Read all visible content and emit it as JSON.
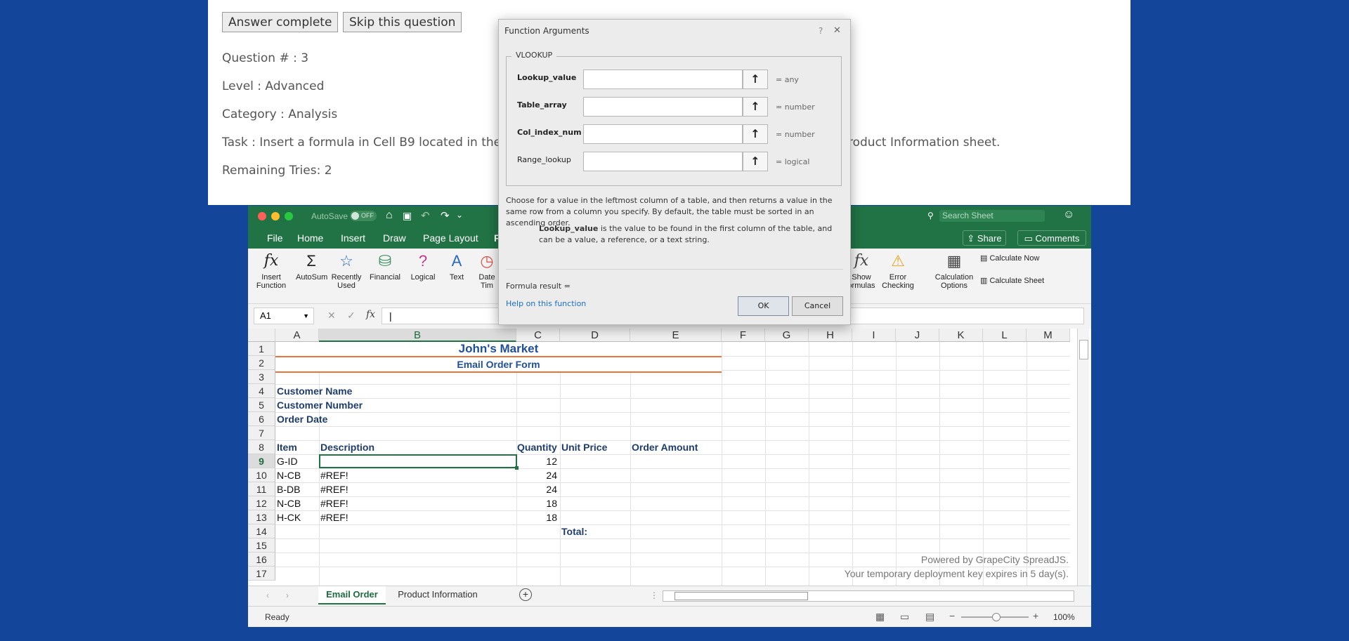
{
  "question": {
    "answer_complete_label": "Answer complete",
    "skip_label": "Skip this question",
    "number": "Question # : 3",
    "level": "Level : Advanced",
    "category": "Category : Analysis",
    "task_part1": "Task : Insert a formula in Cell B9 located in the Ema",
    "task_part2": "roduct Information sheet.",
    "remaining": "Remaining Tries: 2"
  },
  "titlebar": {
    "autosave": "AutoSave",
    "autosave_state": "OFF",
    "search_placeholder": "Search Sheet"
  },
  "ribbon_tabs": [
    "File",
    "Home",
    "Insert",
    "Draw",
    "Page Layout",
    "F"
  ],
  "share_label": "Share",
  "comments_label": "Comments",
  "ribbon": {
    "insert_function": [
      "Insert",
      "Function"
    ],
    "autosum": "AutoSum",
    "recently_used": [
      "Recently",
      "Used"
    ],
    "financial": "Financial",
    "logical": "Logical",
    "text": "Text",
    "datetime": [
      "Date",
      "Tim"
    ],
    "show_formulas": [
      "Show",
      "ormulas"
    ],
    "error_checking": [
      "Error",
      "Checking"
    ],
    "calc_options": [
      "Calculation",
      "Options"
    ],
    "calculate_now": "Calculate Now",
    "calculate_sheet": "Calculate Sheet"
  },
  "formula_bar": {
    "name_box": "A1",
    "fx": "fx",
    "value": "|"
  },
  "columns": [
    "A",
    "B",
    "C",
    "D",
    "E",
    "F",
    "G",
    "H",
    "I",
    "J",
    "K",
    "L",
    "M"
  ],
  "rows": [
    "1",
    "2",
    "3",
    "4",
    "5",
    "6",
    "7",
    "8",
    "9",
    "10",
    "11",
    "12",
    "13",
    "14",
    "15",
    "16",
    "17"
  ],
  "sheet": {
    "title": "John's Market",
    "subtitle": "Email Order Form",
    "customer_name": "Customer Name",
    "customer_number": "Customer Number",
    "order_date": "Order Date",
    "headers": {
      "item": "Item",
      "description": "Description",
      "quantity": "Quantity",
      "unit_price": "Unit Price",
      "order_amount": "Order Amount"
    },
    "items": [
      {
        "item": "G-ID",
        "description": "",
        "quantity": "12"
      },
      {
        "item": "N-CB",
        "description": "#REF!",
        "quantity": "24"
      },
      {
        "item": "B-DB",
        "description": "#REF!",
        "quantity": "24"
      },
      {
        "item": "N-CB",
        "description": "#REF!",
        "quantity": "18"
      },
      {
        "item": "H-CK",
        "description": "#REF!",
        "quantity": "18"
      }
    ],
    "total_label": "Total:",
    "powered_by": "Powered by GrapeCity SpreadJS.",
    "deploy_key": "Your temporary deployment key expires in 5 day(s)."
  },
  "sheet_tabs": [
    "Email Order",
    "Product Information"
  ],
  "status": {
    "ready": "Ready",
    "zoom": "100%"
  },
  "dialog": {
    "title": "Function Arguments",
    "help": "?",
    "group": "VLOOKUP",
    "fields": [
      {
        "label": "Lookup_value",
        "eq": "= any"
      },
      {
        "label": "Table_array",
        "eq": "= number"
      },
      {
        "label": "Col_index_num",
        "eq": "= number"
      },
      {
        "label": "Range_lookup",
        "eq": "= logical"
      }
    ],
    "description": "Choose for a value in the leftmost column of a table, and then returns a value in the same row from a column you specify. By default, the table must be sorted in an ascending order.",
    "arg_name": "Lookup_value",
    "arg_desc": "is the value to be found in the first column of the table, and can be a value, a reference, or a text string.",
    "formula_result": "Formula result =",
    "help_link": "Help on this function",
    "ok": "OK",
    "cancel": "Cancel"
  }
}
